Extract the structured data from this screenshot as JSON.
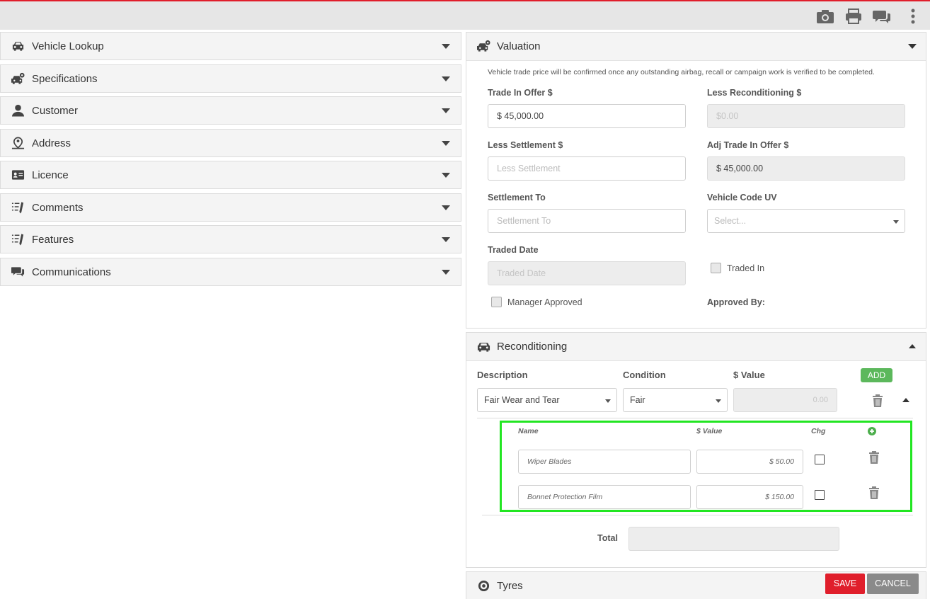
{
  "toolbar": {
    "icons": [
      "camera-icon",
      "print-icon",
      "chat-icon",
      "more-vertical-icon"
    ]
  },
  "sidebar": {
    "items": [
      {
        "label": "Vehicle Lookup",
        "icon": "car-icon"
      },
      {
        "label": "Specifications",
        "icon": "car-settings-icon"
      },
      {
        "label": "Customer",
        "icon": "user-icon"
      },
      {
        "label": "Address",
        "icon": "location-user-icon"
      },
      {
        "label": "Licence",
        "icon": "id-card-icon"
      },
      {
        "label": "Comments",
        "icon": "checklist-pen-icon"
      },
      {
        "label": "Features",
        "icon": "checklist-pen-icon"
      },
      {
        "label": "Communications",
        "icon": "chat-icon"
      }
    ]
  },
  "valuation": {
    "title": "Valuation",
    "note": "Vehicle trade price will be confirmed once any outstanding airbag, recall or campaign work is verified to be completed.",
    "trade_in_offer_label": "Trade In Offer $",
    "trade_in_offer_value": "$ 45,000.00",
    "less_reconditioning_label": "Less Reconditioning $",
    "less_reconditioning_placeholder": "$0.00",
    "less_settlement_label": "Less Settlement $",
    "less_settlement_placeholder": "Less Settlement",
    "adj_trade_in_label": "Adj Trade In Offer $",
    "adj_trade_in_value": "$ 45,000.00",
    "settlement_to_label": "Settlement To",
    "settlement_to_placeholder": "Settlement To",
    "vehicle_code_label": "Vehicle Code UV",
    "vehicle_code_placeholder": "Select...",
    "traded_date_label": "Traded Date",
    "traded_date_placeholder": "Traded Date",
    "traded_in_label": "Traded In",
    "manager_approved_label": "Manager Approved",
    "approved_by_label": "Approved By:"
  },
  "reconditioning": {
    "title": "Reconditioning",
    "col_description": "Description",
    "col_condition": "Condition",
    "col_value": "$ Value",
    "add_label": "ADD",
    "row": {
      "description": "Fair Wear and Tear",
      "condition": "Fair",
      "value_placeholder": "0.00"
    },
    "sub": {
      "col_name": "Name",
      "col_value": "$ Value",
      "col_chg": "Chg",
      "items": [
        {
          "name": "Wiper Blades",
          "value": "$ 50.00"
        },
        {
          "name": "Bonnet Protection Film",
          "value": "$ 150.00"
        }
      ]
    },
    "total_label": "Total"
  },
  "tyres": {
    "title": "Tyres"
  },
  "actions": {
    "save": "SAVE",
    "cancel": "CANCEL"
  }
}
